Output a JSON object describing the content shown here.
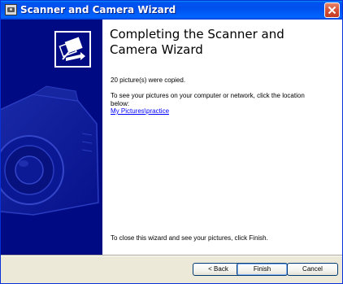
{
  "window": {
    "title": "Scanner and Camera Wizard",
    "title_icon": "scanner-camera-icon",
    "close_icon": "close-icon",
    "colors": {
      "titlebar": "#0054e3",
      "sidebar": "#000a82",
      "dialog_bg": "#ece9d8",
      "close_button": "#d8543a"
    }
  },
  "sidebar": {
    "wizard_icon": "photo-transfer-icon",
    "background_art": "camera-art"
  },
  "main": {
    "heading": "Completing the Scanner and Camera Wizard",
    "copied_message": "20 picture(s) were copied.",
    "instruction": "To see your pictures on your computer or network, click the location below:",
    "location_link": "My Pictures\\practice",
    "closing_instruction": "To close this wizard and see your pictures, click Finish.",
    "link_color": "#0000ff"
  },
  "buttons": {
    "back": "< Back",
    "finish": "Finish",
    "cancel": "Cancel"
  }
}
